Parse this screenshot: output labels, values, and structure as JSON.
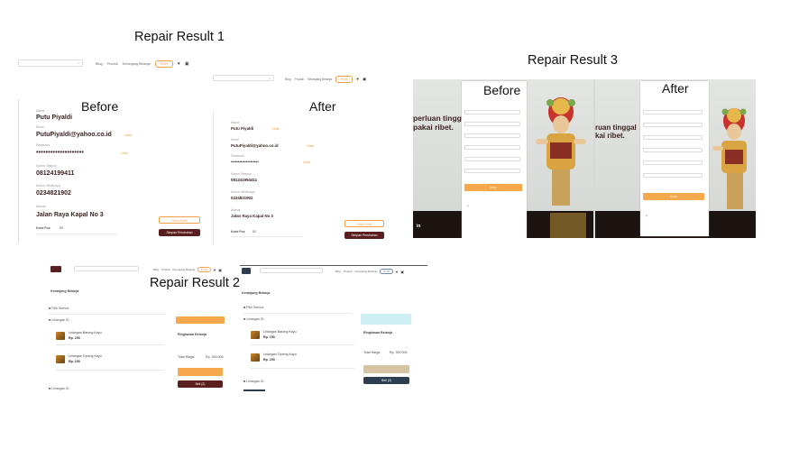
{
  "titles": {
    "r1": "Repair Result 1",
    "r2": "Repair Result 2",
    "r3": "Repair Result 3"
  },
  "labels": {
    "before": "Before",
    "after": "After"
  },
  "r1": {
    "nav": {
      "items": [
        "Blog",
        "Produk",
        "Keranjang Belanja"
      ],
      "cta": "Profil"
    },
    "profile": {
      "name_label": "Nama",
      "name": "Putu Piyaldi",
      "email_label": "Email",
      "email": "PutuPiyaldi@yahoo.co.id",
      "password_label": "Password",
      "password": "••••••••••••••••••••",
      "phone_label": "Nomor Telepon",
      "phone": "08124199411",
      "whatsapp_label": "Nomor WhatsApp",
      "whatsapp": "0234821902",
      "address_label": "Alamat",
      "address": "Jalan Raya Kapal No 3",
      "change": "Ubah",
      "footer_label": "Kode Pos",
      "footer_value": "80",
      "edit_button": "Ubah Profil",
      "save_button": "Simpan Perubahan"
    },
    "profile_after": {
      "name": "Putu Piyaldi",
      "email": "PutuPiyaldi@yahoo.co.id",
      "phone": "081241994411",
      "whatsapp": "0234821902",
      "address": "Jalan Raya Kapal No 3"
    }
  },
  "r2": {
    "nav": {
      "items": [
        "Blog",
        "Produk",
        "Keranjang Belanja"
      ],
      "cta": "Profil"
    },
    "page_title": "Keranjang Belanja",
    "select_all": "Pilih Semua",
    "store": "Lelangan ID",
    "summary_title": "Ringkasan Belanja",
    "total_label": "Total Harga",
    "total_value": "Rp. 300.000",
    "checkout": "Beli (2)",
    "items": [
      {
        "name": "Lelangan Barong Kayu",
        "price": "Rp. 150"
      },
      {
        "name": "Lelangan Topeng Kayu",
        "price": "Rp. 150"
      }
    ]
  },
  "r3": {
    "hero_text_before": [
      "perluan tinggal",
      "pakai ribet."
    ],
    "hero_text_after": [
      "ruan tinggal",
      "kai ribet."
    ],
    "bottom_text": "in",
    "form_button": "Daftar"
  }
}
